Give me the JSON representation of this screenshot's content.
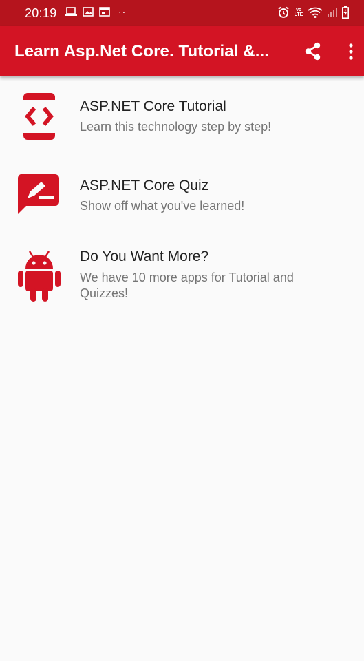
{
  "status_bar": {
    "time": "20:19",
    "dots": "··",
    "volte": "Vo LTE"
  },
  "app_bar": {
    "title": "Learn Asp.Net Core. Tutorial &..."
  },
  "menu_items": [
    {
      "title": "ASP.NET Core Tutorial",
      "subtitle": "Learn this technology step by step!",
      "icon": "code-tablet-icon"
    },
    {
      "title": "ASP.NET Core Quiz",
      "subtitle": "Show off what you've learned!",
      "icon": "quiz-pencil-icon"
    },
    {
      "title": "Do You Want More?",
      "subtitle": "We have 10 more apps for Tutorial and Quizzes!",
      "icon": "android-icon"
    }
  ],
  "colors": {
    "status_bar": "#b5141d",
    "app_bar": "#d31424",
    "icon": "#d31424",
    "background": "#fafafa"
  }
}
